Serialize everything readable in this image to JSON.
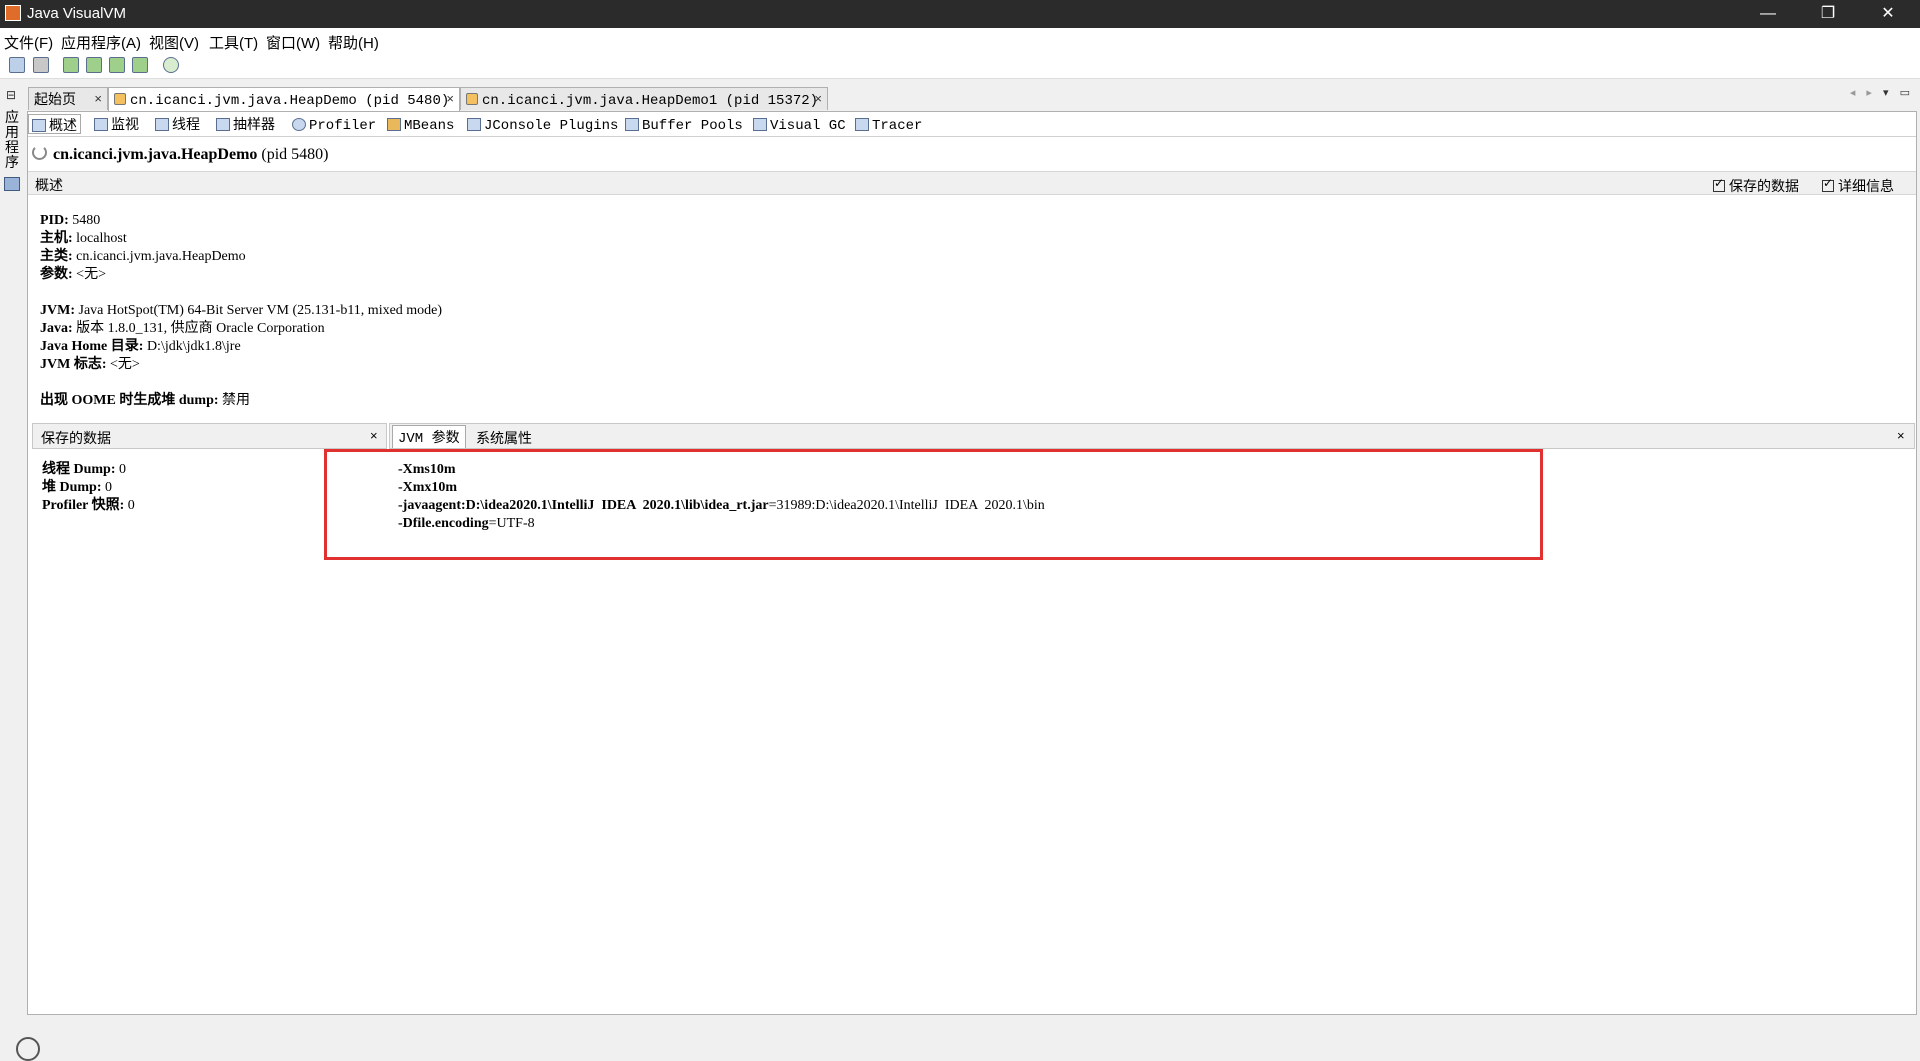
{
  "window": {
    "title": "Java VisualVM",
    "controls": {
      "minimize": "—",
      "restore": "❐",
      "close": "✕"
    }
  },
  "menu": [
    "文件(F)",
    "应用程序(A)",
    "视图(V)",
    "工具(T)",
    "窗口(W)",
    "帮助(H)"
  ],
  "toolbar_icons": [
    "load-snapshot-icon",
    "save-icon",
    "add-jmx-connection-icon",
    "add-remote-host-icon",
    "add-core-dump-icon",
    "take-snapshot-icon"
  ],
  "sidebar": {
    "pin": "⊟",
    "label": "应用程序"
  },
  "doc_tabs": [
    {
      "label": "起始页",
      "close": "×",
      "active": false
    },
    {
      "label": "cn.icanci.jvm.java.HeapDemo (pid 5480)",
      "close": "×",
      "active": true
    },
    {
      "label": "cn.icanci.jvm.java.HeapDemo1 (pid 15372)",
      "close": "×",
      "active": false
    }
  ],
  "nav": {
    "left": "◂",
    "right": "▸",
    "menu": "▾",
    "restore": "▭"
  },
  "subtabs": [
    {
      "label": "概述",
      "icon": "overview-icon"
    },
    {
      "label": "监视",
      "icon": "monitor-icon"
    },
    {
      "label": "线程",
      "icon": "threads-icon"
    },
    {
      "label": "抽样器",
      "icon": "sampler-icon"
    },
    {
      "label": "Profiler",
      "icon": "profiler-icon"
    },
    {
      "label": "MBeans",
      "icon": "mbeans-icon"
    },
    {
      "label": "JConsole Plugins",
      "icon": "jconsole-plugins-icon"
    },
    {
      "label": "Buffer Pools",
      "icon": "buffer-pools-icon"
    },
    {
      "label": "Visual GC",
      "icon": "visual-gc-icon"
    },
    {
      "label": "Tracer",
      "icon": "tracer-icon"
    }
  ],
  "heading": {
    "name": "cn.icanci.jvm.java.HeapDemo",
    "pid": "(pid 5480)"
  },
  "overview": {
    "section_label": "概述",
    "checkboxes": [
      {
        "label": "保存的数据",
        "checked": true
      },
      {
        "label": "详细信息",
        "checked": true
      }
    ],
    "info": [
      {
        "key": "PID:",
        "value": " 5480"
      },
      {
        "key": "主机:",
        "value": " localhost"
      },
      {
        "key": "主类:",
        "value": " cn.icanci.jvm.java.HeapDemo"
      },
      {
        "key": "参数:",
        "value": " <无>"
      },
      {
        "key": "JVM:",
        "value": " Java HotSpot(TM) 64-Bit Server VM (25.131-b11, mixed mode)"
      },
      {
        "key": "Java:",
        "value": " 版本 1.8.0_131, 供应商 Oracle Corporation"
      },
      {
        "key": "Java Home 目录:",
        "value": " D:\\jdk\\jdk1.8\\jre"
      },
      {
        "key": "JVM 标志:",
        "value": " <无>"
      },
      {
        "key": "出现 OOME 时生成堆 dump:",
        "value": " 禁用"
      }
    ]
  },
  "saved_data": {
    "title": "保存的数据",
    "close": "×",
    "items": [
      {
        "key": "线程 Dump:",
        "value": " 0"
      },
      {
        "key": "堆 Dump:",
        "value": " 0"
      },
      {
        "key": "Profiler 快照:",
        "value": " 0"
      }
    ]
  },
  "jvm_panel": {
    "tab_jvm": "JVM 参数",
    "tab_sys": "系统属性",
    "close": "×",
    "args": [
      {
        "key": "-Xms10m",
        "value": ""
      },
      {
        "key": "-Xmx10m",
        "value": ""
      },
      {
        "key": "-javaagent:D:\\idea2020.1\\IntelliJ  IDEA  2020.1\\lib\\idea_rt.jar",
        "value": "=31989:D:\\idea2020.1\\IntelliJ  IDEA  2020.1\\bin"
      },
      {
        "key": "-Dfile.encoding",
        "value": "=UTF-8"
      }
    ]
  },
  "colors": {
    "highlight": "#e03030",
    "titlebar": "#2b2b2b"
  }
}
